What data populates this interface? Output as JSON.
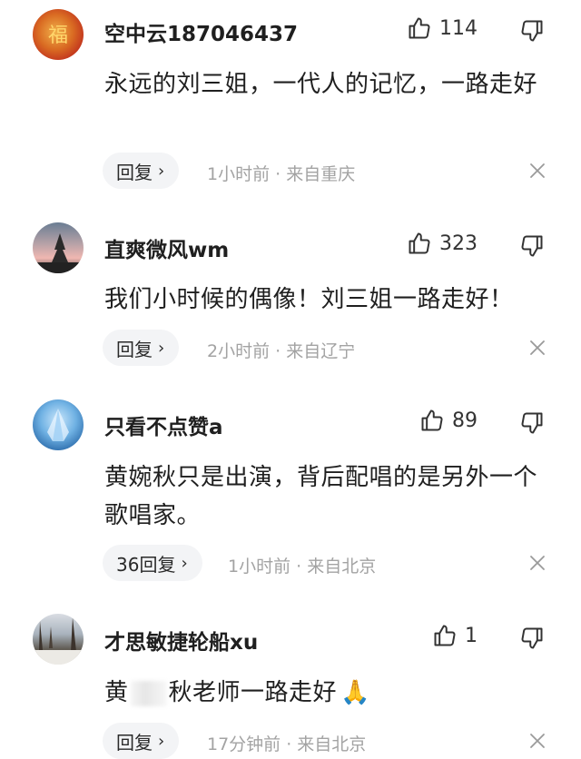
{
  "comments": [
    {
      "username": "空中云187046437",
      "like_count": "114",
      "text": "永远的刘三姐，一代人的记忆，一路走好",
      "reply_label": "回复",
      "meta": "1小时前 · 来自重庆"
    },
    {
      "username": "直爽微风wm",
      "like_count": "323",
      "text": "我们小时候的偶像！刘三姐一路走好！",
      "reply_label": "回复",
      "meta": "2小时前 · 来自辽宁"
    },
    {
      "username": "只看不点赞a",
      "like_count": "89",
      "text": "黄婉秋只是出演，背后配唱的是另外一个歌唱家。",
      "reply_label": "36回复",
      "meta": "1小时前 · 来自北京"
    },
    {
      "username": "才思敏捷轮船xu",
      "like_count": "1",
      "text_before": "黄",
      "text_after": "秋老师一路走好",
      "emoji": "🙏",
      "reply_label": "回复",
      "meta": "17分钟前 · 来自北京"
    }
  ],
  "icons": {
    "like": "thumbs-up-icon",
    "dislike": "thumbs-down-icon",
    "close": "close-icon",
    "chevron": "chevron-right-icon"
  }
}
